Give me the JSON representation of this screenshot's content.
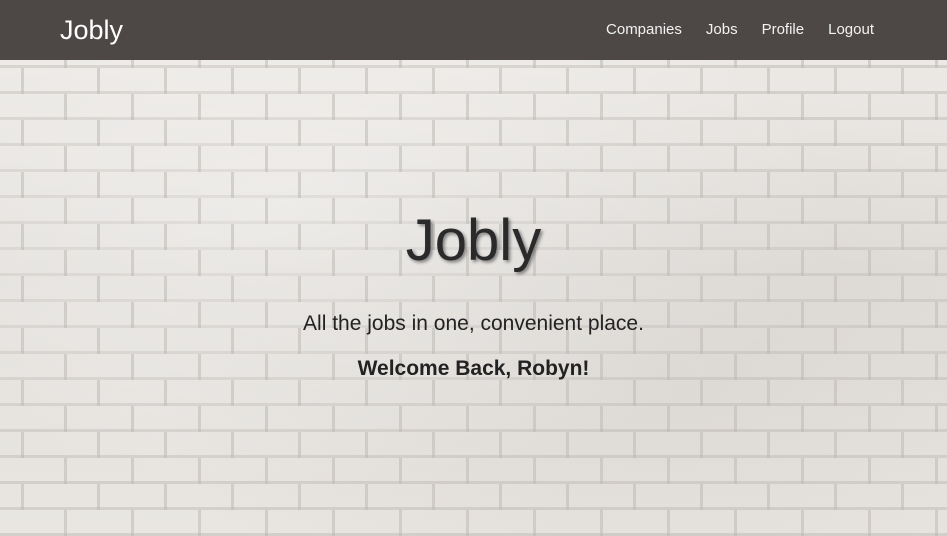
{
  "navbar": {
    "brand": "Jobly",
    "links": [
      {
        "label": "Companies"
      },
      {
        "label": "Jobs"
      },
      {
        "label": "Profile"
      },
      {
        "label": "Logout"
      }
    ],
    "background_color": "#4d4746"
  },
  "hero": {
    "title": "Jobly",
    "tagline": "All the jobs in one, convenient place.",
    "welcome": "Welcome Back, Robyn!"
  }
}
